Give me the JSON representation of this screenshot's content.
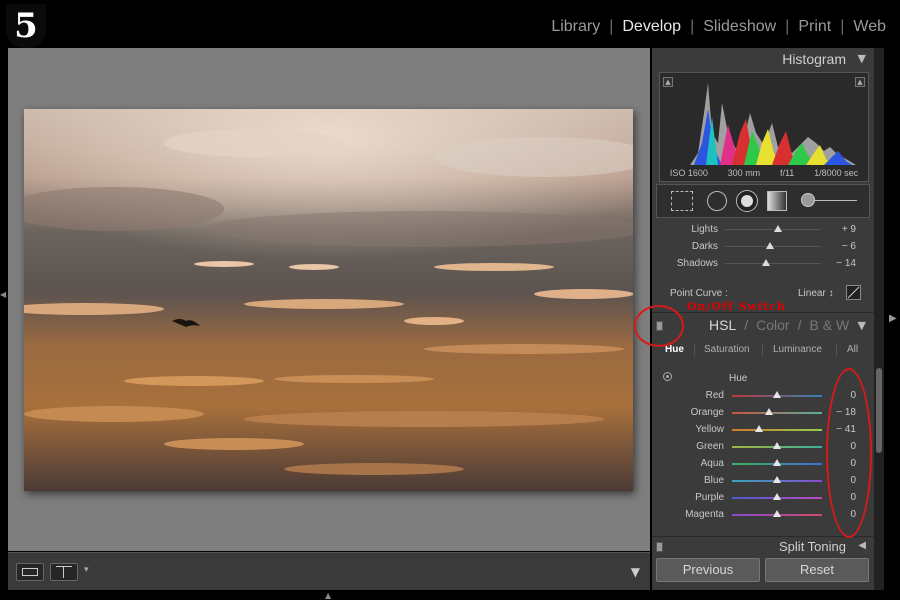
{
  "step_badge": "5",
  "modules": {
    "library": "Library",
    "develop": "Develop",
    "slideshow": "Slideshow",
    "print": "Print",
    "web": "Web",
    "separator": "|"
  },
  "histogram": {
    "title": "Histogram",
    "iso": "ISO 1600",
    "focal": "300 mm",
    "aperture": "f/11",
    "shutter": "1/8000 sec"
  },
  "tone": {
    "rows": [
      {
        "label": "Lights",
        "value": "+ 9",
        "level": 0.55
      },
      {
        "label": "Darks",
        "value": "− 6",
        "level": 0.47
      },
      {
        "label": "Shadows",
        "value": "− 14",
        "level": 0.43
      }
    ],
    "point_curve_label": "Point Curve :",
    "point_curve_value": "Linear ↕"
  },
  "hsl": {
    "tabs": {
      "hsl": "HSL",
      "color": "Color",
      "bw": "B & W",
      "sep": "/"
    },
    "subtabs": {
      "hue": "Hue",
      "saturation": "Saturation",
      "luminance": "Luminance",
      "all": "All"
    },
    "section_title": "Hue",
    "rows": [
      {
        "label": "Red",
        "value": "0",
        "level": 0.5,
        "colors": [
          "#b63a3a",
          "#3a7db6"
        ]
      },
      {
        "label": "Orange",
        "value": "− 18",
        "level": 0.41,
        "colors": [
          "#c9553a",
          "#5bb0a0"
        ]
      },
      {
        "label": "Yellow",
        "value": "− 41",
        "level": 0.3,
        "colors": [
          "#d07a2a",
          "#8fd04a"
        ]
      },
      {
        "label": "Green",
        "value": "0",
        "level": 0.5,
        "colors": [
          "#a5b43a",
          "#3ab0a0"
        ]
      },
      {
        "label": "Aqua",
        "value": "0",
        "level": 0.5,
        "colors": [
          "#3fb063",
          "#3a6fd0"
        ]
      },
      {
        "label": "Blue",
        "value": "0",
        "level": 0.5,
        "colors": [
          "#36a6b6",
          "#8a4ad0"
        ]
      },
      {
        "label": "Purple",
        "value": "0",
        "level": 0.5,
        "colors": [
          "#4a5ad0",
          "#c04ac0"
        ]
      },
      {
        "label": "Magenta",
        "value": "0",
        "level": 0.5,
        "colors": [
          "#8a4ad0",
          "#d04a6a"
        ]
      }
    ]
  },
  "split_toning": {
    "title": "Split Toning"
  },
  "buttons": {
    "previous": "Previous",
    "reset": "Reset"
  },
  "annotation": {
    "label": "On/Off Switch",
    "color": "#d81a1a"
  }
}
